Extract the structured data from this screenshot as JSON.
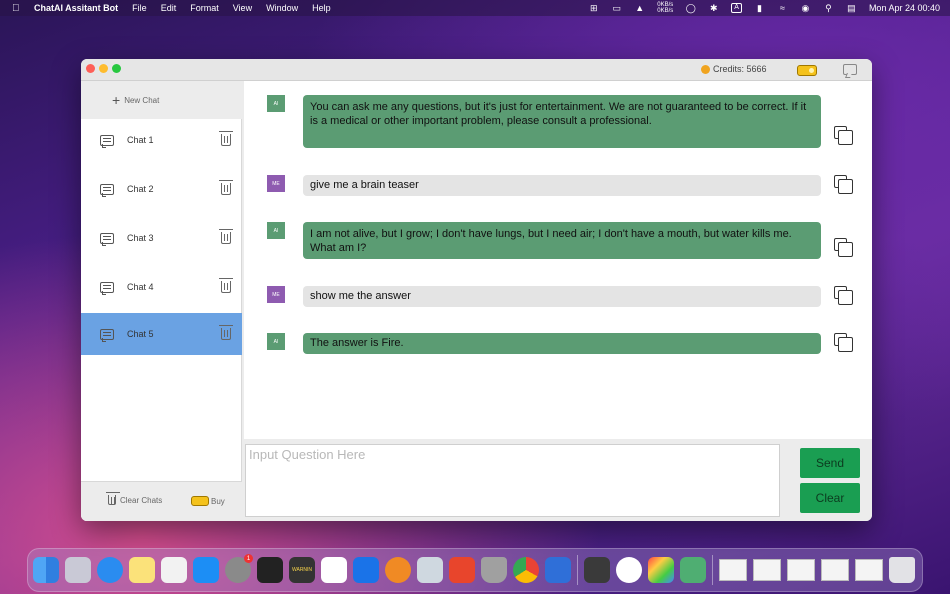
{
  "menubar": {
    "app_name": "ChatAI Assitant Bot",
    "menus": [
      "File",
      "Edit",
      "Format",
      "View",
      "Window",
      "Help"
    ],
    "net_up": "0KB/s",
    "net_down": "0KB/s",
    "input_source": "A",
    "datetime": "Mon Apr 24  00:40"
  },
  "titlebar": {
    "credits_label": "Credits: 5666"
  },
  "sidebar": {
    "new_chat_label": "New Chat",
    "chats": [
      {
        "label": "Chat 1",
        "selected": false
      },
      {
        "label": "Chat 2",
        "selected": false
      },
      {
        "label": "Chat 3",
        "selected": false
      },
      {
        "label": "Chat 4",
        "selected": false
      },
      {
        "label": "Chat 5",
        "selected": true
      }
    ],
    "clear_chats_label": "Clear Chats",
    "buy_label": "Buy"
  },
  "messages": [
    {
      "role": "AI",
      "text": "You can ask me any questions, but it's just for entertainment. We are not guaranteed to be correct. If it is a medical or other important problem, please consult a professional."
    },
    {
      "role": "ME",
      "text": "give me a brain teaser"
    },
    {
      "role": "AI",
      "text": "I am not alive, but I grow; I don't have lungs, but I need air; I don't have a mouth, but water kills me. What am I?"
    },
    {
      "role": "ME",
      "text": "show me the answer"
    },
    {
      "role": "AI",
      "text": "The answer is Fire."
    }
  ],
  "input": {
    "placeholder": "Input Question Here",
    "value": ""
  },
  "buttons": {
    "send": "Send",
    "clear": "Clear"
  },
  "dock": {
    "settings_badge": "1",
    "console_text": "WARNIN"
  },
  "colors": {
    "ai_bubble": "#5b9c73",
    "me_bubble": "#e4e4e4",
    "selected_chat": "#6aa2e3",
    "action_button": "#1a9e52"
  }
}
